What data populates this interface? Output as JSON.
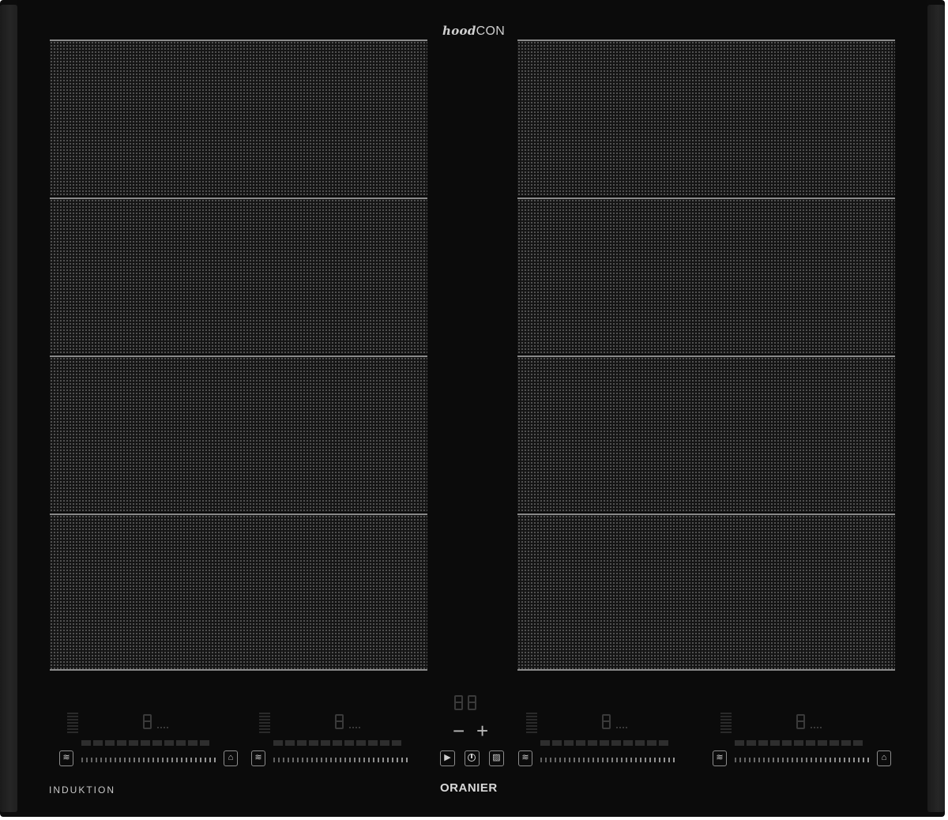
{
  "brand": {
    "top_logo_italic": "hood",
    "top_logo_plain": "CON",
    "bottom_left_label": "INDUKTION",
    "bottom_center_label": "ORANIER"
  },
  "cooking_zones": {
    "left_column_sections": 4,
    "right_column_sections": 4
  },
  "controls": {
    "zone_controls": [
      {
        "position": "front-left"
      },
      {
        "position": "rear-left"
      },
      {
        "position": "front-right"
      },
      {
        "position": "rear-right"
      }
    ],
    "center": {
      "minus_label": "−",
      "plus_label": "+"
    }
  },
  "colors": {
    "glass": "#0b0b0b",
    "frame_edge": "#222222",
    "zone_grid": "#5a5a5a",
    "zone_separator": "#8a8a8a",
    "control_text": "#cfcfcf"
  },
  "icons": [
    "heat-waves-icon",
    "boost-icon",
    "play-pause-icon",
    "power-icon",
    "lock-icon"
  ]
}
